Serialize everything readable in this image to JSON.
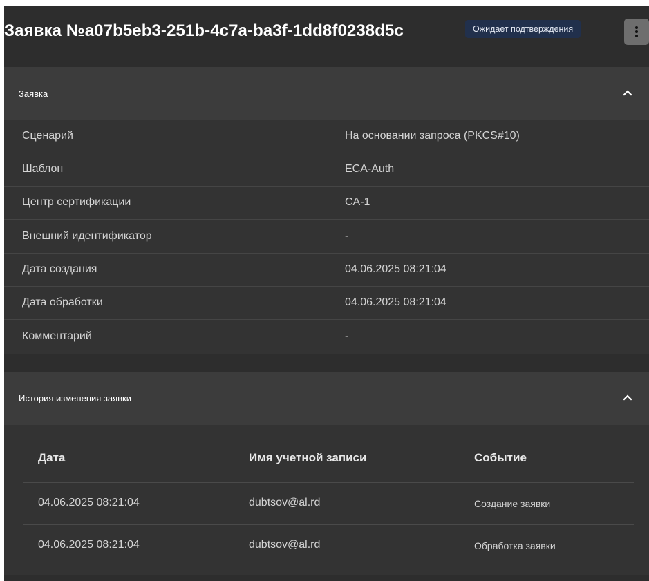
{
  "header": {
    "title": "Заявка №a07b5eb3-251b-4c7a-ba3f-1dd8f0238d5c",
    "status": "Ожидает подтверждения",
    "menu_icon": "more-vertical-icon"
  },
  "details": {
    "title": "Заявка",
    "toggle_icon": "chevron-up-icon",
    "rows": [
      {
        "label": "Сценарий",
        "value": "На основании запроса (PKCS#10)"
      },
      {
        "label": "Шаблон",
        "value": "ECA-Auth"
      },
      {
        "label": "Центр сертификации",
        "value": "CA-1"
      },
      {
        "label": "Внешний идентификатор",
        "value": "-"
      },
      {
        "label": "Дата создания",
        "value": "04.06.2025 08:21:04"
      },
      {
        "label": "Дата обработки",
        "value": "04.06.2025 08:21:04"
      },
      {
        "label": "Комментарий",
        "value": "-"
      }
    ]
  },
  "history": {
    "title": "История изменения заявки",
    "toggle_icon": "chevron-up-icon",
    "columns": [
      "Дата",
      "Имя учетной записи",
      "Событие"
    ],
    "rows": [
      {
        "date": "04.06.2025 08:21:04",
        "account": "dubtsov@al.rd",
        "event": "Создание заявки"
      },
      {
        "date": "04.06.2025 08:21:04",
        "account": "dubtsov@al.rd",
        "event": "Обработка заявки"
      }
    ]
  },
  "colors": {
    "background": "#2d2d2d",
    "section_header": "#3c3c3c",
    "section_body": "#333333",
    "status_badge": "#21304c"
  }
}
